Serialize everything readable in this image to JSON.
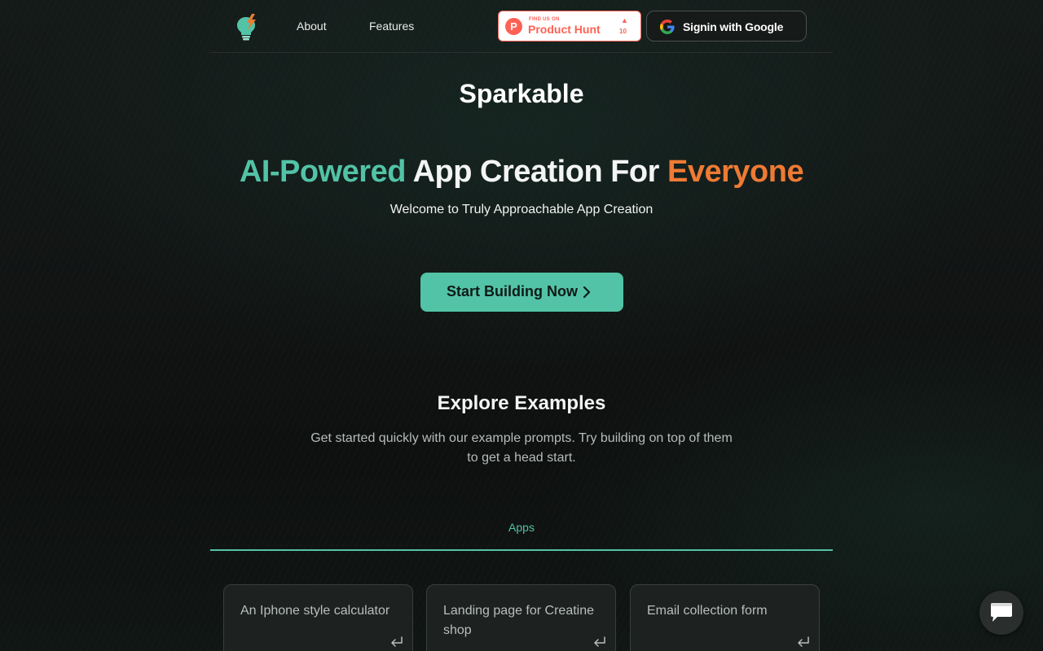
{
  "nav": {
    "about": "About",
    "features": "Features",
    "product_hunt": {
      "small": "FIND US ON",
      "name": "Product Hunt",
      "count": "10",
      "arrow": "▲",
      "logo_letter": "P"
    },
    "google_signin": "Signin with Google"
  },
  "hero": {
    "brand": "Sparkable",
    "headline_green": "AI-Powered",
    "headline_middle": " App Creation For ",
    "headline_orange": "Everyone",
    "subtitle": "Welcome to Truly Approachable App Creation",
    "cta": "Start Building Now"
  },
  "examples": {
    "title": "Explore Examples",
    "description": "Get started quickly with our example prompts. Try building on top of them to get a head start.",
    "tab": "Apps",
    "cards": [
      {
        "text": "An Iphone style calculator"
      },
      {
        "text": "Landing page for Creatine shop"
      },
      {
        "text": "Email collection form"
      }
    ]
  },
  "colors": {
    "accent_green": "#52c3a6",
    "accent_orange": "#ee7a34",
    "product_hunt": "#ff6154",
    "background": "#0f1211"
  }
}
